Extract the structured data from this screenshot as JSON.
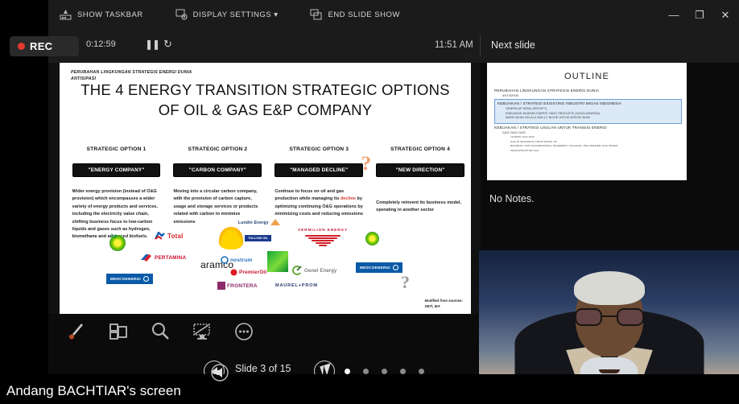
{
  "toolbar": {
    "items": [
      {
        "label": "SHOW TASKBAR",
        "icon": "taskbar-icon"
      },
      {
        "label": "DISPLAY SETTINGS ▾",
        "icon": "display-settings-icon"
      },
      {
        "label": "END SLIDE SHOW",
        "icon": "end-slideshow-icon"
      }
    ],
    "window_controls": {
      "minimize": "—",
      "restore": "❐",
      "close": "✕"
    }
  },
  "recording": {
    "badge": "REC",
    "elapsed": "0:12:59",
    "pause": "❚❚",
    "restart": "↻",
    "clock": "11:51 AM",
    "accent": "#e23b2e"
  },
  "next_pane": {
    "label": "Next slide",
    "notes": "No Notes.",
    "outline": {
      "title": "OUTLINE",
      "items": [
        {
          "level": 1,
          "text": "PERUBAHAN LINGKUNGAN STRATEGIS ENERGI DUNIA",
          "highlight": false
        },
        {
          "level": 2,
          "text": "ANTISIPASI",
          "highlight": false
        },
        {
          "level": 1,
          "text": "KEBIJAKAN / STRATEGI EXSISTING INDUSTRI MIGAS INDONESIA",
          "highlight": true
        },
        {
          "level": 2,
          "text": "GEMERLAP SEMU (REDUP?)",
          "highlight": true
        },
        {
          "level": 2,
          "text": "KEBIJAKAN BAURAN ENERGI YANG OBSOLETE (KADALUWARSA)",
          "highlight": true
        },
        {
          "level": 2,
          "text": "MASIH AKAN SELALU ADA (?) NICHE UNTUK MINYAK BUMI",
          "highlight": true
        },
        {
          "level": 1,
          "text": "KEBIJAKAN / STRATEGI USULAN UNTUK TRANSISI ENERGI",
          "highlight": false
        },
        {
          "level": 2,
          "text": "GAS! GAS! GAS!",
          "highlight": false
        },
        {
          "level": 3,
          "text": "18 BOPD GAS 2030",
          "highlight": false
        },
        {
          "level": 3,
          "text": "GAS DI INDONESIA TIMUR MASIH OK",
          "highlight": false
        },
        {
          "level": 3,
          "text": "BIOGENIK, NON KONVENSIONAL, BASEMENT, VULKANIK, PRA TERSIER, DAN HIDRAT",
          "highlight": false
        },
        {
          "level": 3,
          "text": "INFRASTRUKTUR GAS",
          "highlight": false
        }
      ]
    }
  },
  "slide": {
    "kicker_line1": "PERUBAHAN LINGKUNGAN STRATEGIS ENERGI DUNIA",
    "kicker_line2": "ANTISIPASI",
    "title_line1": "THE 4 ENERGY TRANSITION STRATEGIC OPTIONS",
    "title_line2": "OF OIL & GAS E&P COMPANY",
    "credit": "Modified from sources:\nSBTi, IEA",
    "options": [
      {
        "heading": "STRATEGIC OPTION 1",
        "chip": "\"ENERGY COMPANY\"",
        "body": "Wider energy provision (instead of O&G provision) which encompasses a wider variety of energy products and services, including the electricity value chain, shifting business focus to low-carbon liquids and gases such as hydrogen, biomethane and advanced biofuels."
      },
      {
        "heading": "STRATEGIC OPTION 2",
        "chip": "\"CARBON COMPANY\"",
        "body": "Moving into a circular carbon company, with the provision of carbon capture, usage and storage services or products related with carbon to minimize emissions"
      },
      {
        "heading": "STRATEGIC OPTION 3",
        "chip": "\"MANAGED DECLINE\"",
        "body_pre": "Continue to focus on oil and gas production while managing its ",
        "body_highlight": "decline",
        "body_post": " by optimizing continuing O&G operations by minimizing costs and reducing emissions",
        "marker": "?"
      },
      {
        "heading": "STRATEGIC OPTION 4",
        "chip": "\"NEW DIRECTION\"",
        "body": "Completely reinvent its business model, operating in another sector"
      }
    ],
    "logos": [
      "bp",
      "Total",
      "Shell",
      "PERTAMINA",
      "aramco",
      "MEDCOENERGI",
      "Lundin Energy",
      "TULLOW OIL",
      "VERMILION ENERGY",
      "nostrum",
      "PremierOil",
      "Genel Energy",
      "FRONTERA",
      "MAUREL+PROM"
    ]
  },
  "ink_tools": [
    {
      "name": "pen-icon",
      "label": "Pen"
    },
    {
      "name": "slides-grid-icon",
      "label": "See all slides"
    },
    {
      "name": "magnifier-icon",
      "label": "Zoom into slide"
    },
    {
      "name": "blank-screen-icon",
      "label": "Black or unblank slide show"
    },
    {
      "name": "more-options-icon",
      "label": "More slide show options"
    }
  ],
  "navigation": {
    "prev_label": "◀",
    "slide_counter": "Slide 3 of 15",
    "progress_percent": 20,
    "cursor_label": "Pointer options",
    "dot_count": 5,
    "active_dot": 0
  },
  "share_bar": {
    "label": "Andang BACHTIAR's screen"
  }
}
